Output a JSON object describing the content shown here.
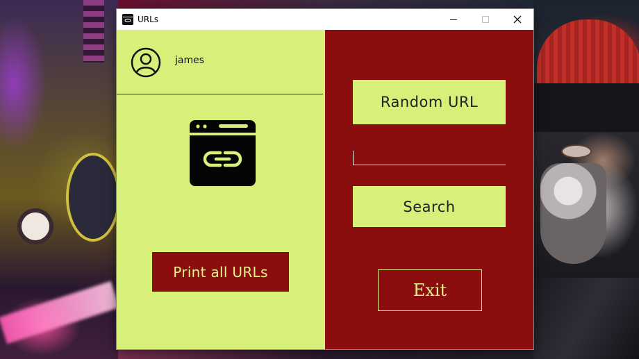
{
  "window": {
    "title": "URLs",
    "icon": "link-window-icon",
    "controls": {
      "minimize": "—",
      "maximize": "☐",
      "close": "✕"
    }
  },
  "user": {
    "name": "james",
    "avatar_icon": "user-circle-icon"
  },
  "left": {
    "logo_icon": "browser-link-icon",
    "print_all_label": "Print all URLs"
  },
  "right": {
    "random_url_label": "Random URL",
    "search_value": "",
    "search_label": "Search",
    "exit_label": "Exit"
  },
  "colors": {
    "lime": "#d6f07a",
    "crimson": "#8b0e0f",
    "button_text_light": "#e4ef8c"
  }
}
